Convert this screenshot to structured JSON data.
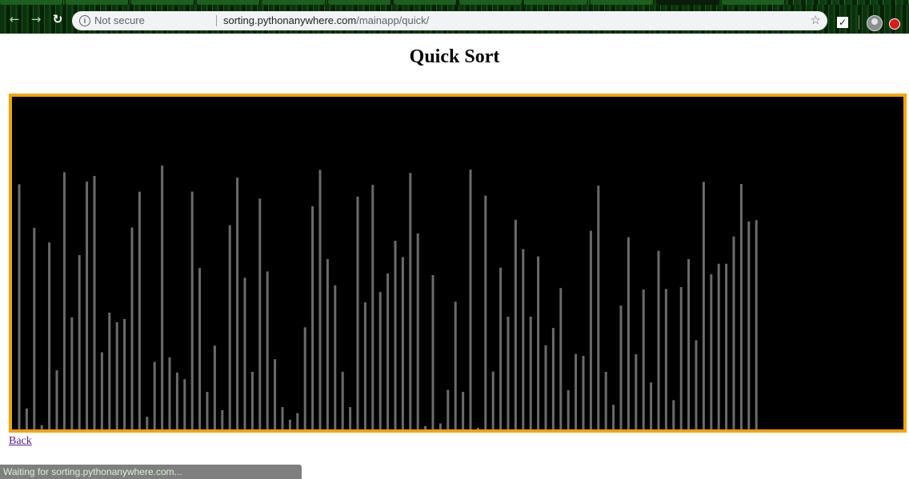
{
  "browser": {
    "security_label": "Not secure",
    "url_host": "sorting.pythonanywhere.com",
    "url_path": "/mainapp/quick/",
    "status_text": "Waiting for sorting.pythonanywhere.com..."
  },
  "page": {
    "title": "Quick Sort",
    "back_link": "Back"
  },
  "visualization": {
    "background_color": "#000000",
    "border_color": "#f5a300",
    "bar_color": "#6b6b6b",
    "bar_heights_fraction": [
      0.737,
      0.063,
      0.606,
      0.013,
      0.562,
      0.178,
      0.773,
      0.337,
      0.524,
      0.745,
      0.762,
      0.232,
      0.351,
      0.322,
      0.332,
      0.607,
      0.715,
      0.038,
      0.203,
      0.793,
      0.217,
      0.171,
      0.151,
      0.715,
      0.485,
      0.113,
      0.252,
      0.058,
      0.614,
      0.757,
      0.456,
      0.173,
      0.694,
      0.475,
      0.211,
      0.067,
      0.029,
      0.049,
      0.307,
      0.671,
      0.78,
      0.512,
      0.433,
      0.173,
      0.067,
      0.7,
      0.382,
      0.735,
      0.413,
      0.469,
      0.567,
      0.518,
      0.771,
      0.589,
      0.01,
      0.464,
      0.018,
      0.119,
      0.384,
      0.113,
      0.781,
      0.005,
      0.703,
      0.174,
      0.486,
      0.339,
      0.63,
      0.542,
      0.339,
      0.52,
      0.253,
      0.305,
      0.425,
      0.118,
      0.227,
      0.221,
      0.597,
      0.733,
      0.173,
      0.074,
      0.372,
      0.578,
      0.226,
      0.421,
      0.141,
      0.537,
      0.422,
      0.088,
      0.428,
      0.512,
      0.268,
      0.744,
      0.466,
      0.498,
      0.498,
      0.58,
      0.738,
      0.625,
      0.629
    ]
  }
}
